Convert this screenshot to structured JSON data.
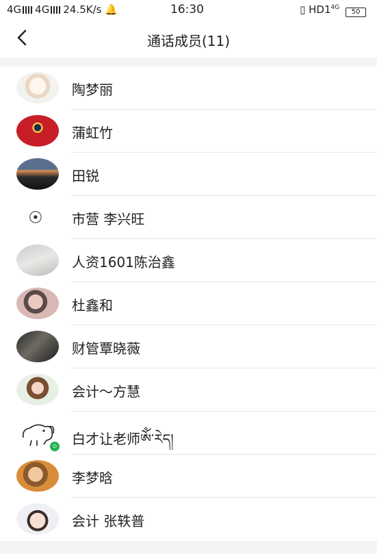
{
  "status_bar": {
    "left": "4G ııl 4G ııl 24.5K/s",
    "time": "16:30",
    "right": "HD1",
    "battery": "50"
  },
  "header": {
    "title": "通话成员(11)",
    "back_icon": "chevron-left-icon"
  },
  "members": [
    {
      "name": "陶梦丽",
      "avatar": "cartoon-girl"
    },
    {
      "name": "蒲虹竹",
      "avatar": "red-figure"
    },
    {
      "name": "田锐",
      "avatar": "sunset-silhouette"
    },
    {
      "name": "市营 李兴旺",
      "avatar": "sketch-drawing"
    },
    {
      "name": "人资1601陈治鑫",
      "avatar": "grey-flower"
    },
    {
      "name": "杜鑫和",
      "avatar": "girl-photo"
    },
    {
      "name": "财管覃晓薇",
      "avatar": "dark-photo"
    },
    {
      "name": "会计～方慧",
      "avatar": "doll-photo"
    },
    {
      "name": "白才让老师ཨོཾ་རེད།",
      "avatar": "dog-doodle"
    },
    {
      "name": "李梦晗",
      "avatar": "woman-photo"
    },
    {
      "name": "会计 张轶普",
      "avatar": "child-angel"
    }
  ]
}
